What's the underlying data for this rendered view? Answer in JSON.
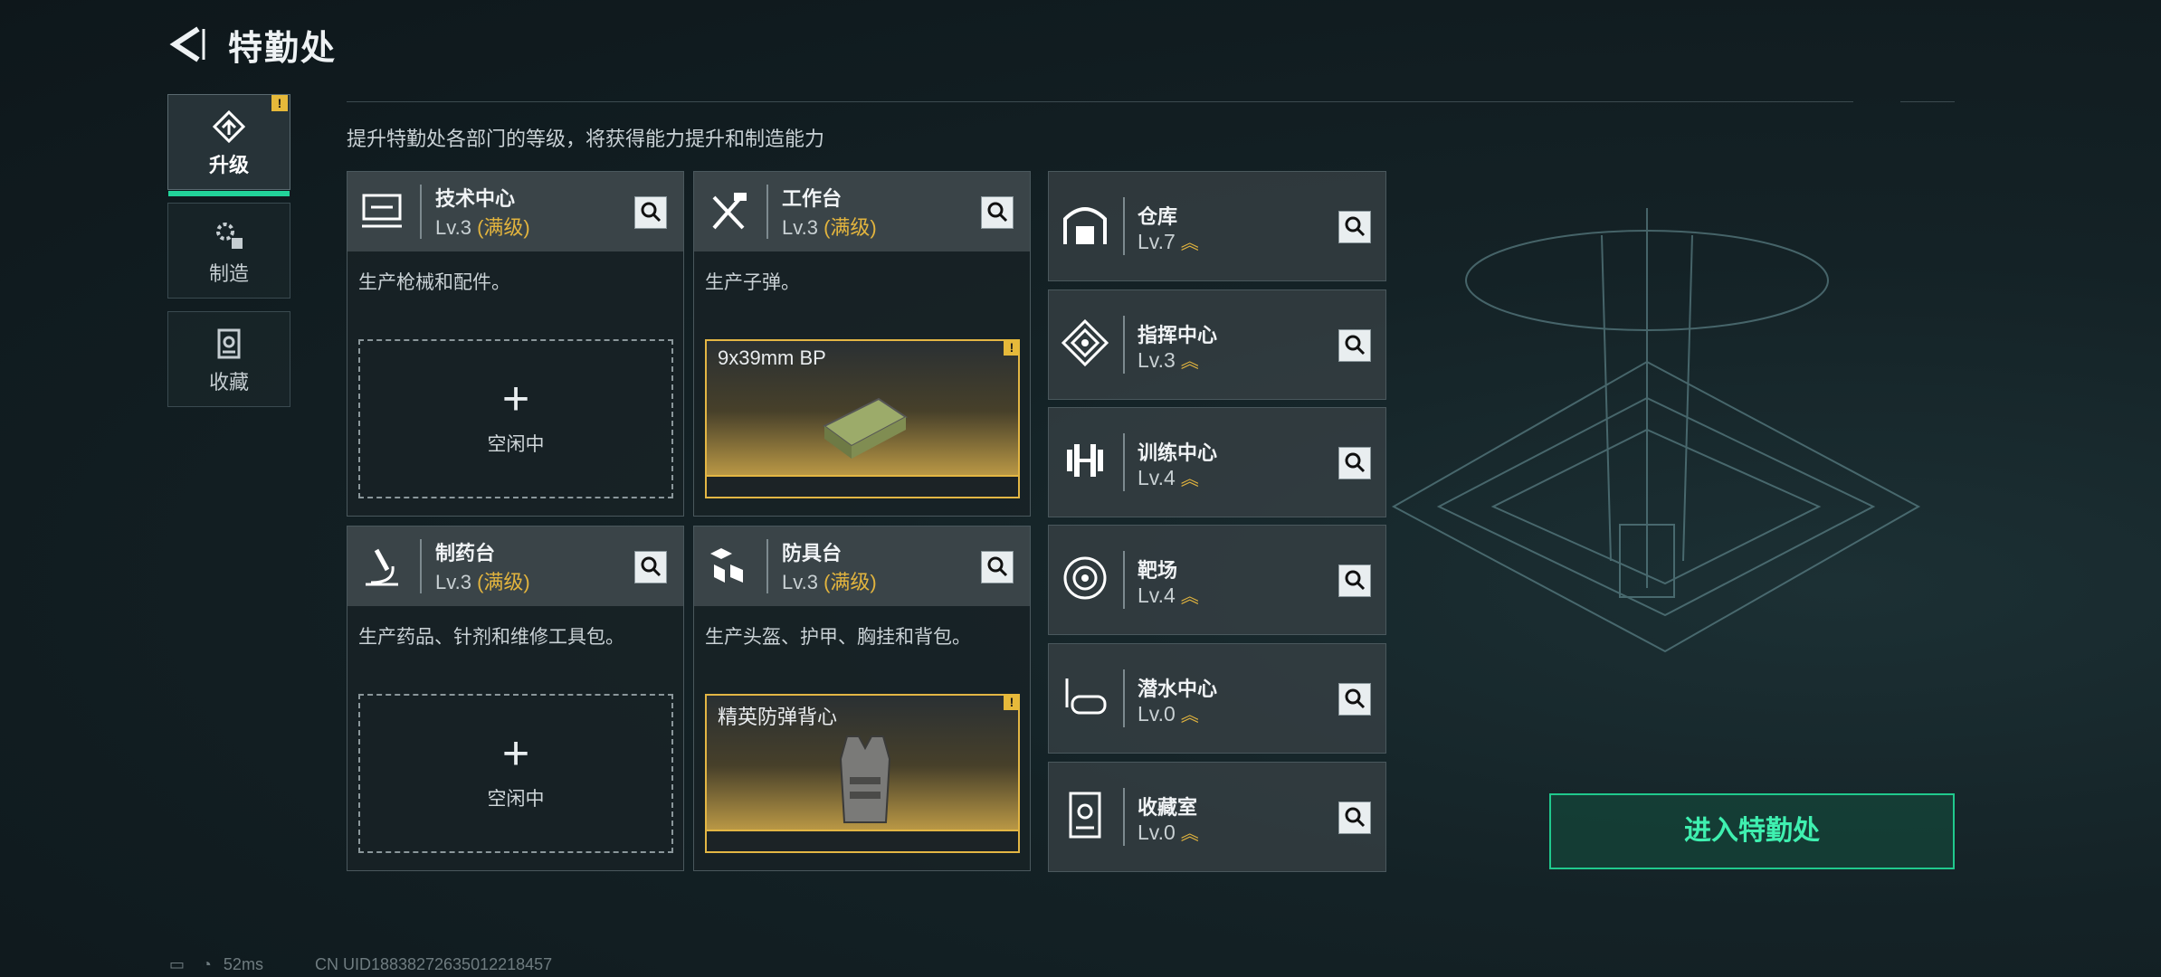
{
  "header": {
    "title": "特勤处"
  },
  "nav": [
    {
      "label": "升级",
      "badge": "!"
    },
    {
      "label": "制造"
    },
    {
      "label": "收藏"
    }
  ],
  "subtitle": "提升特勤处各部门的等级，将获得能力提升和制造能力",
  "cards": [
    {
      "name": "技术中心",
      "level": "Lv.3",
      "max": "(满级)",
      "desc": "生产枪械和配件。",
      "state": "空闲中",
      "plus": "+"
    },
    {
      "name": "工作台",
      "level": "Lv.3",
      "max": "(满级)",
      "desc": "生产子弹。",
      "product": "9x39mm BP",
      "flag": "!"
    },
    {
      "name": "制药台",
      "level": "Lv.3",
      "max": "(满级)",
      "desc": "生产药品、针剂和维修工具包。",
      "state": "空闲中",
      "plus": "+"
    },
    {
      "name": "防具台",
      "level": "Lv.3",
      "max": "(满级)",
      "desc": "生产头盔、护甲、胸挂和背包。",
      "product": "精英防弹背心",
      "flag": "!"
    }
  ],
  "facilities": [
    {
      "name": "仓库",
      "level": "Lv.7"
    },
    {
      "name": "指挥中心",
      "level": "Lv.3"
    },
    {
      "name": "训练中心",
      "level": "Lv.4"
    },
    {
      "name": "靶场",
      "level": "Lv.4"
    },
    {
      "name": "潜水中心",
      "level": "Lv.0"
    },
    {
      "name": "收藏室",
      "level": "Lv.0"
    }
  ],
  "enter_button": "进入特勤处",
  "footer": {
    "ping": "52ms",
    "uid": "CN UID18838272635012218457"
  },
  "colors": {
    "accent_green": "#22d39a",
    "gold": "#e2b43e"
  }
}
